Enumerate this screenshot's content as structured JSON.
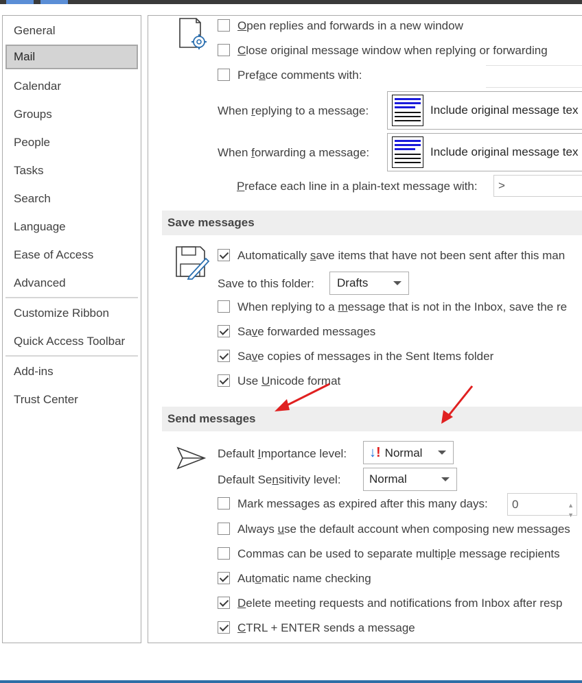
{
  "sidebar": {
    "items": [
      {
        "label": "General"
      },
      {
        "label": "Mail"
      },
      {
        "label": "Calendar"
      },
      {
        "label": "Groups"
      },
      {
        "label": "People"
      },
      {
        "label": "Tasks"
      },
      {
        "label": "Search"
      },
      {
        "label": "Language"
      },
      {
        "label": "Ease of Access"
      },
      {
        "label": "Advanced"
      },
      {
        "label": "Customize Ribbon"
      },
      {
        "label": "Quick Access Toolbar"
      },
      {
        "label": "Add-ins"
      },
      {
        "label": "Trust Center"
      }
    ],
    "selected": "Mail"
  },
  "replies": {
    "open_new_window": {
      "pre": "",
      "u": "O",
      "post": "pen replies and forwards in a new window",
      "checked": false
    },
    "close_original": {
      "pre": "",
      "u": "C",
      "post": "lose original message window when replying or forwarding",
      "checked": false
    },
    "preface_comments": {
      "pre": "Pref",
      "u": "a",
      "post": "ce comments with:",
      "checked": false
    },
    "when_replying_label": {
      "pre": "When ",
      "u": "r",
      "post": "eplying to a message:"
    },
    "when_replying_value": "Include original message tex",
    "when_forwarding_label": {
      "pre": "When ",
      "u": "f",
      "post": "orwarding a message:"
    },
    "when_forwarding_value": "Include original message tex",
    "preface_plain_label": {
      "pre": "",
      "u": "P",
      "post": "reface each line in a plain-text message with:"
    },
    "preface_plain_value": ">"
  },
  "save_messages": {
    "header": "Save messages",
    "auto_save": {
      "pre": "Automatically ",
      "u": "s",
      "post": "ave items that have not been sent after this man",
      "checked": true
    },
    "save_folder_label": "Save to this folder:",
    "save_folder_value": "Drafts",
    "not_in_inbox": {
      "pre": "When replying to a ",
      "u": "m",
      "post": "essage that is not in the Inbox, save the re",
      "checked": false
    },
    "save_forwarded": {
      "pre": "Sa",
      "u": "v",
      "post": "e forwarded messages",
      "checked": true
    },
    "save_copies": {
      "pre": "Sa",
      "u": "v",
      "post": "e copies of messages in the Sent Items folder",
      "checked": true
    },
    "unicode": {
      "pre": "Use ",
      "u": "U",
      "post": "nicode format",
      "checked": true
    }
  },
  "send_messages": {
    "header": "Send messages",
    "importance_label": {
      "pre": "Default ",
      "u": "I",
      "post": "mportance level:"
    },
    "importance_value": "Normal",
    "sensitivity_label": {
      "pre": "Default Se",
      "u": "n",
      "post": "sitivity level:"
    },
    "sensitivity_value": "Normal",
    "mark_expired": {
      "pre": "Mark messa",
      "u": "g",
      "post": "es as expired after this many days:",
      "checked": false
    },
    "expired_days": "0",
    "always_default": {
      "pre": "Always ",
      "u": "u",
      "post": "se the default account when composing new messages",
      "checked": false
    },
    "commas": {
      "pre": "Commas can be used to separate multip",
      "u": "l",
      "post": "e message recipients",
      "checked": false
    },
    "auto_name": {
      "pre": "Aut",
      "u": "o",
      "post": "matic name checking",
      "checked": true
    },
    "delete_meeting": {
      "pre": "",
      "u": "D",
      "post": "elete meeting requests and notifications from Inbox after resp",
      "checked": true
    },
    "ctrl_enter": {
      "pre": "",
      "u": "C",
      "post": "TRL + ENTER sends a message",
      "checked": true
    }
  },
  "colors": {
    "annotation_arrow": "#e02020",
    "importance_blue": "#1e6fd9",
    "importance_red": "#e02020",
    "section_header_bg": "#eeeeee",
    "selected_nav_bg": "#d4d4d4"
  }
}
